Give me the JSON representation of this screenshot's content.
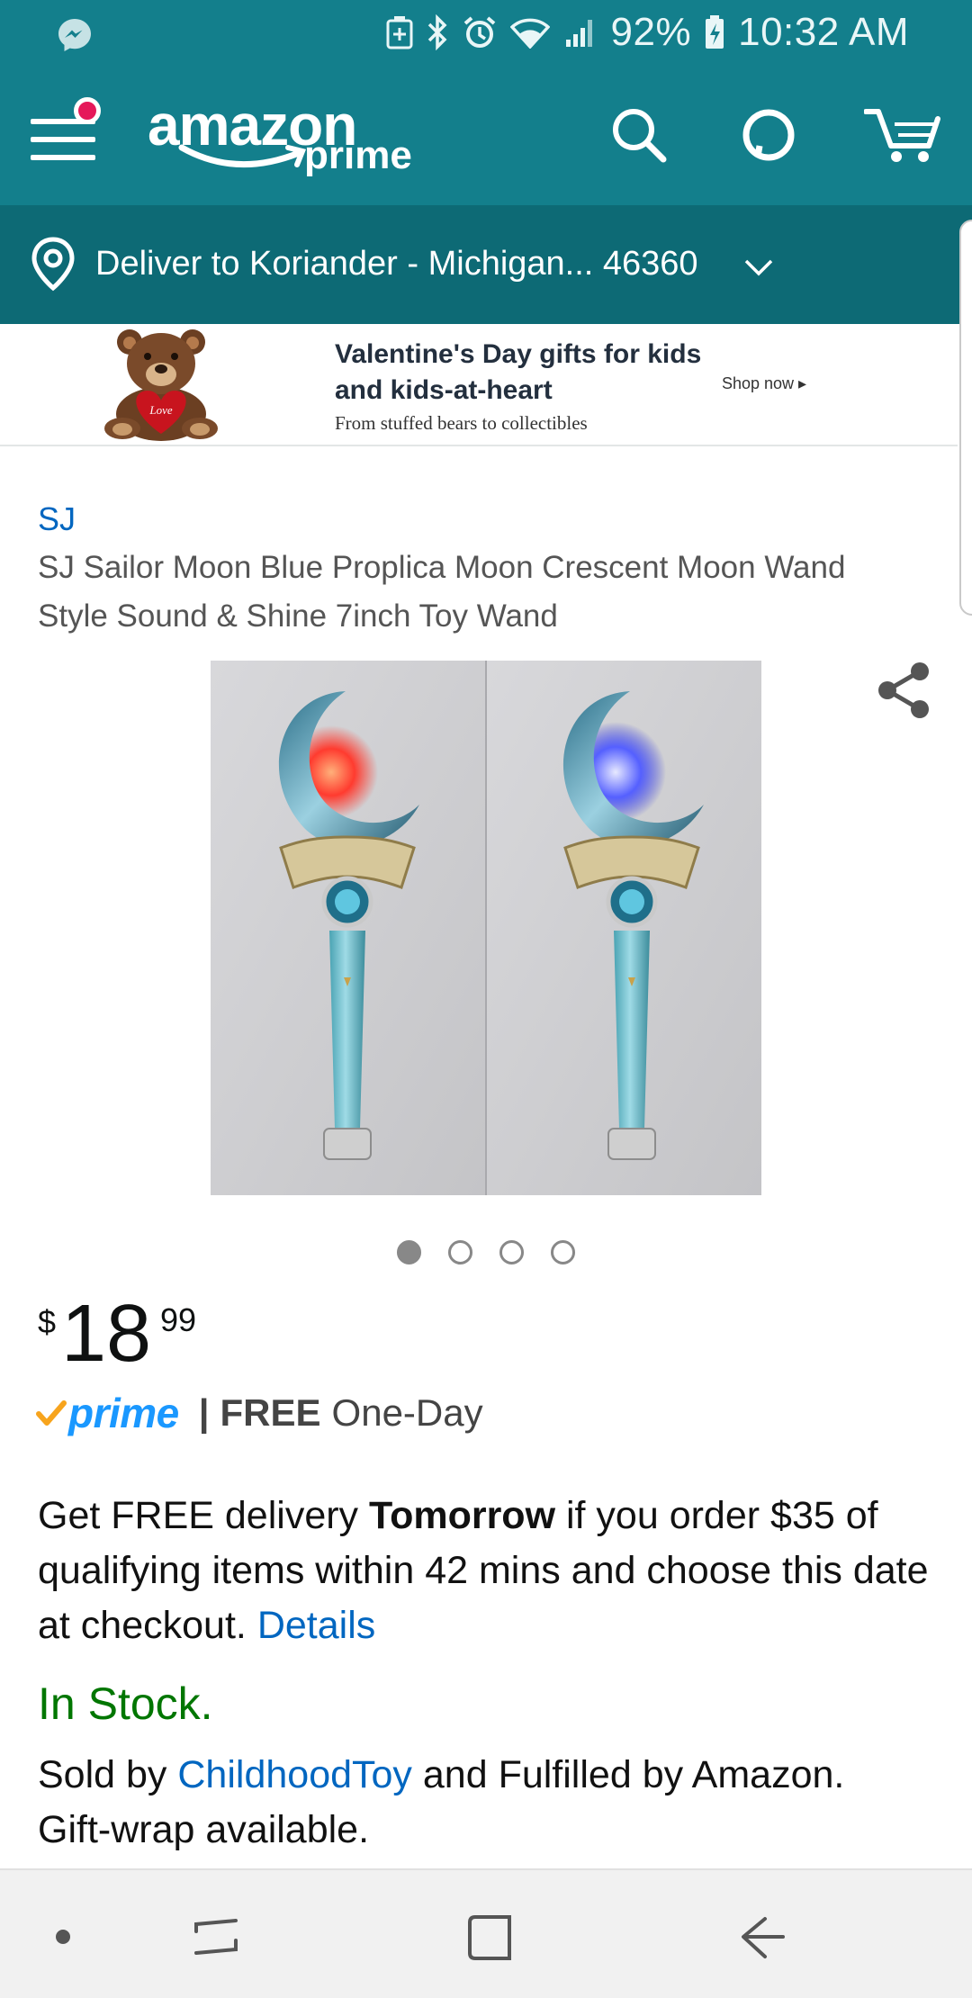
{
  "status_bar": {
    "battery_percent": "92%",
    "time": "10:32 AM",
    "icons": [
      "messenger-icon",
      "data-saver-icon",
      "bluetooth-icon",
      "alarm-icon",
      "wifi-icon",
      "signal-icon",
      "battery-charging-icon"
    ]
  },
  "header": {
    "logo_main": "amazon",
    "logo_sub": "prime",
    "icons": [
      "menu-icon",
      "search-icon",
      "alexa-icon",
      "cart-icon"
    ],
    "accent_color": "#137f8c",
    "notification_color": "#e5185a"
  },
  "deliver": {
    "text": "Deliver to Koriander - Michigan... 46360",
    "bar_color": "#0d6a75"
  },
  "banner": {
    "title": "Valentine's Day gifts for kids and kids-at-heart",
    "subtitle": "From stuffed bears to collectibles",
    "cta": "Shop now ▸",
    "bear_heart_text": "Love"
  },
  "product": {
    "brand": "SJ",
    "title": "SJ Sailor Moon Blue Proplica Moon Crescent Moon Wand Style Sound & Shine 7inch Toy Wand",
    "image_count": 4,
    "active_image": 1
  },
  "price": {
    "currency": "$",
    "whole": "18",
    "fraction": "99"
  },
  "prime": {
    "badge": "prime",
    "separator": "|",
    "free": "FREE",
    "speed": "One-Day"
  },
  "delivery": {
    "part1": "Get FREE delivery ",
    "bold": "Tomorrow",
    "part2": " if you order $35 of qualifying items within 42 mins and choose this date at checkout. ",
    "link": "Details"
  },
  "stock": {
    "status": "In Stock.",
    "sold_prefix": "Sold by ",
    "seller": "ChildhoodToy",
    "sold_suffix": " and Fulfilled by Amazon.",
    "gift": "Gift-wrap available.",
    "status_color": "#007600"
  },
  "colors": {
    "link": "#0066c0",
    "prime_blue": "#1a98ff",
    "prime_check": "#f7a41d"
  }
}
